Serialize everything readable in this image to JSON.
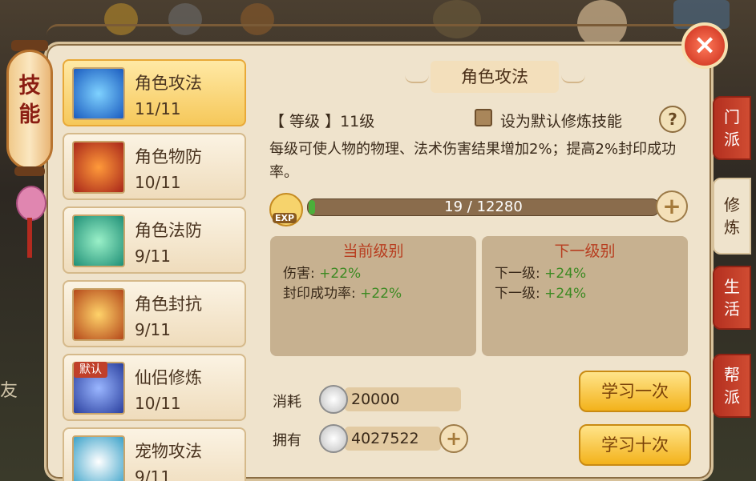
{
  "lantern": {
    "label": "技能"
  },
  "skills": [
    {
      "name": "角色攻法",
      "level": "11/11",
      "selected": true,
      "color": "#1a5bbf"
    },
    {
      "name": "角色物防",
      "level": "10/11",
      "selected": false,
      "color": "#a8261a"
    },
    {
      "name": "角色法防",
      "level": "9/11",
      "selected": false,
      "color": "#1f8f76"
    },
    {
      "name": "角色封抗",
      "level": "9/11",
      "selected": false,
      "color": "#b4481a"
    },
    {
      "name": "仙侣修炼",
      "level": "10/11",
      "selected": false,
      "badge": "默认",
      "color": "#2a3f9e"
    },
    {
      "name": "宠物攻法",
      "level": "9/11",
      "selected": false,
      "color": "#3ba2c9"
    }
  ],
  "detail": {
    "title": "角色攻法",
    "level_line": "【 等级 】11级",
    "default_checkbox_label": "设为默认修炼技能",
    "help": "?",
    "description": "每级可使人物的物理、法术伤害结果增加2%；提高2%封印成功率。",
    "exp_icon_label": "EXP",
    "exp_text": "19 / 12280",
    "exp_progress": 0.0015
  },
  "current_box": {
    "title": "当前级别",
    "lines": [
      {
        "label": "伤害:",
        "value": "+22%"
      },
      {
        "label": "封印成功率:",
        "value": "+22%"
      }
    ]
  },
  "next_box": {
    "title": "下一级别",
    "lines": [
      {
        "label": "下一级:",
        "value": "+24%"
      },
      {
        "label": "下一级:",
        "value": "+24%"
      }
    ]
  },
  "cost": {
    "label": "消耗",
    "value": "20000"
  },
  "owned": {
    "label": "拥有",
    "value": "4027522"
  },
  "buttons": {
    "learn_once": "学习一次",
    "learn_ten": "学习十次"
  },
  "tabs": [
    {
      "label": "门派",
      "active": false
    },
    {
      "label": "修炼",
      "active": true
    },
    {
      "label": "生活",
      "active": false
    },
    {
      "label": "帮派",
      "active": false
    }
  ],
  "close": "×",
  "plus": "+",
  "background_text": {
    "friend": "友"
  }
}
